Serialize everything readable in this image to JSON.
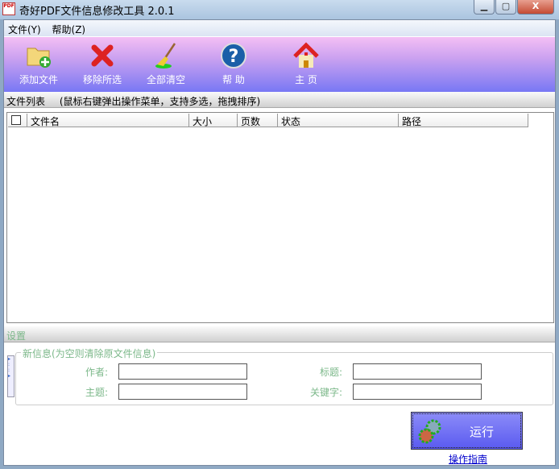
{
  "window": {
    "title": "奇好PDF文件信息修改工具 2.0.1",
    "app_icon_text": "PDF"
  },
  "menu": [
    {
      "label": "文件(Y)"
    },
    {
      "label": "帮助(Z)"
    }
  ],
  "toolbar": [
    {
      "label": "添加文件",
      "icon": "add-folder-icon"
    },
    {
      "label": "移除所选",
      "icon": "red-x-icon"
    },
    {
      "label": "全部清空",
      "icon": "broom-icon"
    },
    {
      "label": "帮 助",
      "icon": "help-icon"
    },
    {
      "label": "主 页",
      "icon": "home-icon"
    }
  ],
  "file_list": {
    "title": "文件列表",
    "hint": "(鼠标右键弹出操作菜单，支持多选，拖拽排序)",
    "columns": [
      "文件名",
      "大小",
      "页数",
      "状态",
      "路径"
    ],
    "rows": []
  },
  "settings": {
    "title": "设置",
    "group_title": "新信息(为空则清除原文件信息)",
    "author_label": "作者:",
    "title_label": "标题:",
    "subject_label": "主题:",
    "keywords_label": "关键字:",
    "author": "",
    "doc_title": "",
    "subject": "",
    "keywords": ""
  },
  "run_label": "运行",
  "guide_link": "操作指南"
}
